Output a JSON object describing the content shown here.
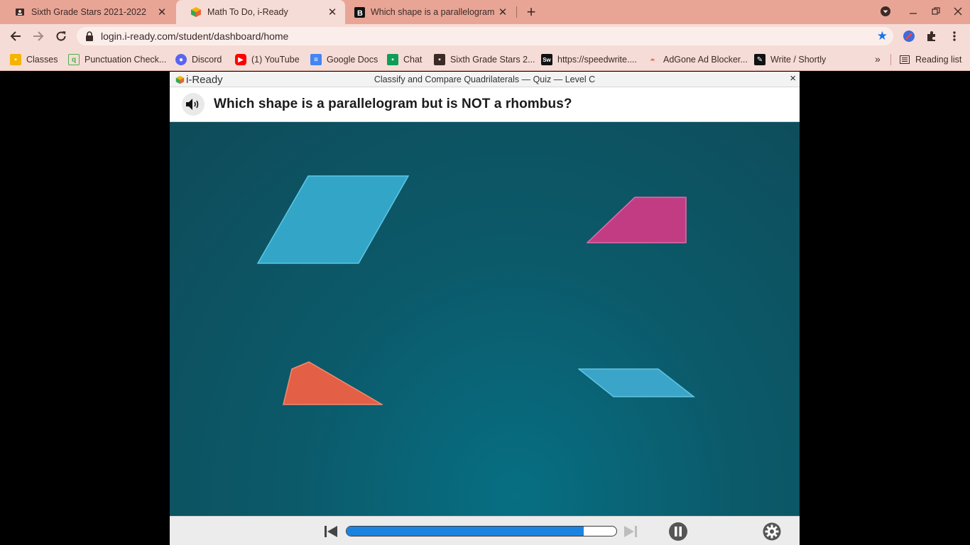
{
  "browser": {
    "tabs": [
      {
        "title": "Sixth Grade Stars 2021-2022",
        "icon": "classroom-icon",
        "active": false
      },
      {
        "title": "Math To Do, i-Ready",
        "icon": "iready-icon",
        "active": true
      },
      {
        "title": "Which shape is a parallelogram",
        "icon": "brainly-icon",
        "active": false
      }
    ],
    "url": "login.i-ready.com/student/dashboard/home",
    "bookmarks": [
      {
        "label": "Classes",
        "icon": "classroom-icon",
        "color": "#f4b400"
      },
      {
        "label": "Punctuation Check...",
        "icon": "search-doc-icon",
        "color": "#4caf50"
      },
      {
        "label": "Discord",
        "icon": "discord-icon",
        "color": "#5865f2"
      },
      {
        "label": "(1) YouTube",
        "icon": "youtube-icon",
        "color": "#ff0000"
      },
      {
        "label": "Google Docs",
        "icon": "docs-icon",
        "color": "#4285f4"
      },
      {
        "label": "Chat",
        "icon": "chat-icon",
        "color": "#0f9d58"
      },
      {
        "label": "Sixth Grade Stars 2...",
        "icon": "classroom-icon",
        "color": "#3b2a26"
      },
      {
        "label": "https://speedwrite....",
        "icon": "speedwrite-icon",
        "color": "#111111"
      },
      {
        "label": "AdGone Ad Blocker...",
        "icon": "adgone-icon",
        "color": "#e5735a"
      },
      {
        "label": "Write / Shortly",
        "icon": "shortly-icon",
        "color": "#111111"
      }
    ],
    "reading_list": "Reading list",
    "more_bookmarks": "»"
  },
  "lesson": {
    "brand": "i-Ready",
    "title": "Classify and Compare Quadrilaterals — Quiz — Level C",
    "close": "×",
    "question": "Which shape is a parallelogram but is NOT a rhombus?",
    "progress_fraction": 0.88,
    "shape_colors": {
      "rhombus": "#33a6c8",
      "trapezoid": "#c13c83",
      "kite_triangle": "#e35f45",
      "parallelogram": "#3aa4c9"
    }
  },
  "colors": {
    "tabstrip": "#e8a596",
    "toolbar": "#f6dcd6",
    "stage": "#0b5a6a",
    "progress": "#1a84e0"
  }
}
